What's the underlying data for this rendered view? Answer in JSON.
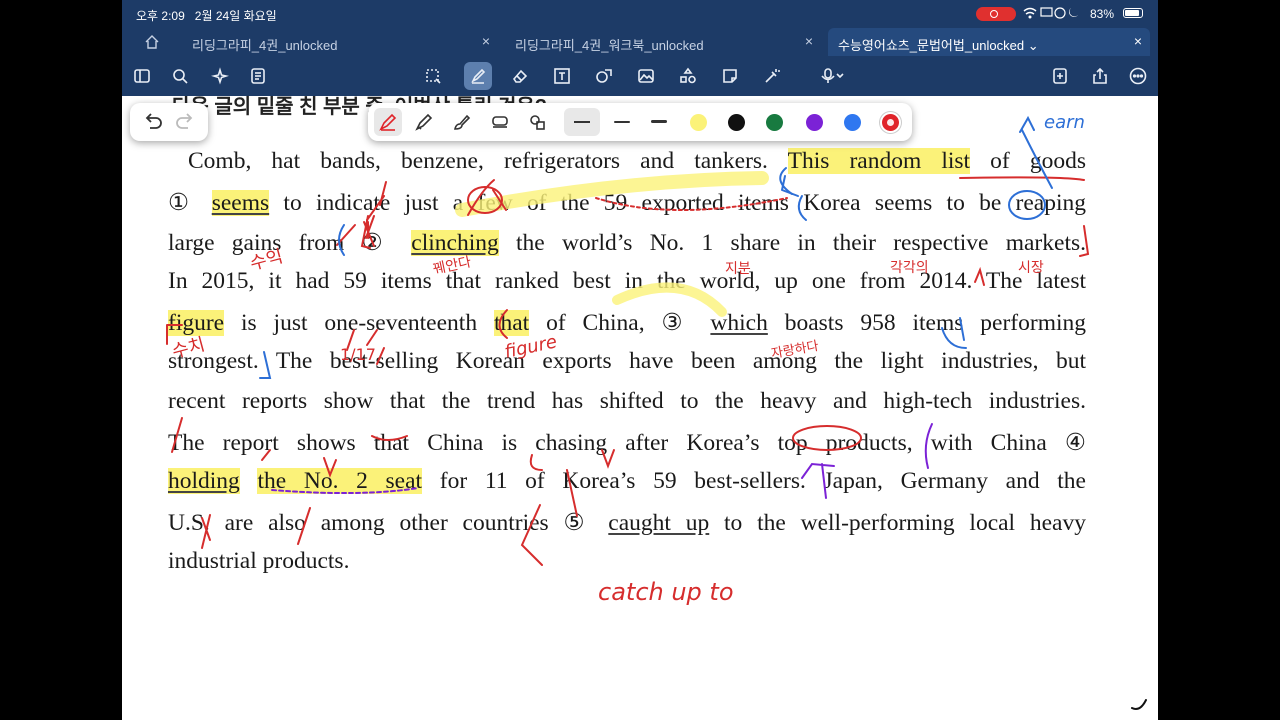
{
  "status": {
    "time": "오후 2:09",
    "date": "2월 24일 화요일",
    "battery": "83%"
  },
  "tabs": [
    {
      "label": "리딩그라피_4권_unlocked",
      "active": false
    },
    {
      "label": "리딩그라피_4권_워크북_unlocked",
      "active": false
    },
    {
      "label": "수능영어쇼츠_문법어법_unlocked",
      "active": true
    }
  ],
  "toolbar": {
    "icons": [
      "sidebar-icon",
      "search-icon",
      "sparkle-icon",
      "document-list-icon",
      "lasso-icon",
      "pen-icon",
      "eraser-icon",
      "text-box-icon",
      "shapes-icon",
      "image-icon",
      "elements-icon",
      "sticky-note-icon",
      "laser-pointer-icon",
      "microphone-icon",
      "add-page-icon",
      "share-icon",
      "more-icon"
    ]
  },
  "pen_tray": {
    "tools": [
      "fountain-pen-icon",
      "ball-pen-icon",
      "brush-pen-icon",
      "highlighter-icon",
      "shape-pen-icon"
    ],
    "colors": [
      "#fbf279",
      "#111111",
      "#187a40",
      "#7b22d6",
      "#2f77f0",
      "#e0242a"
    ],
    "selected_color": "#e0242a"
  },
  "document": {
    "cut_heading": "다음 글의 밑줄 친 부분 중, 어법상 틀린 것은?",
    "l1": [
      "Comb, hat bands, benzene, refrigerators and tankers. ",
      "This random list",
      " of goods"
    ],
    "l2": [
      "① ",
      "seems",
      " to indicate just a few of the 59 exported items Korea seems to be reaping"
    ],
    "l3": [
      "large gains from ② ",
      "clinching",
      " the world’s No. 1 share in their respective markets."
    ],
    "l4": [
      "In 2015, it had 59 items that ranked best in the world, up one from 2014. The latest"
    ],
    "l5": [
      "figure",
      " is just one-seventeenth ",
      "that",
      " of China, ③ ",
      "which",
      " boasts 958 items performing"
    ],
    "l6": [
      "strongest. The best-selling Korean exports have been among the light industries, but"
    ],
    "l7": [
      "recent reports show that the trend has shifted to the heavy and high-tech industries."
    ],
    "l8": [
      "The report shows that China is chasing after Korea’s top products, with China ④"
    ],
    "l9": [
      "holding",
      " ",
      "the No. 2 seat",
      " for 11 of Korea’s 59 best-sellers. Japan, Germany and the"
    ],
    "l10": [
      "U.S. are also among other countries ⑤ ",
      "caught up",
      " to the well-performing local heavy"
    ],
    "l11": [
      "industrial products."
    ]
  },
  "handwriting": {
    "earn": "earn",
    "sue_ik": "수익",
    "kkweon": "꿰안다",
    "jibun": "지분",
    "gakgakui": "각각의",
    "sijang": "시장",
    "suchi": "수치",
    "figure": "figure",
    "jarang": "자랑하다",
    "one_seventeen": "1/17",
    "catch_up": "catch   up   to"
  }
}
